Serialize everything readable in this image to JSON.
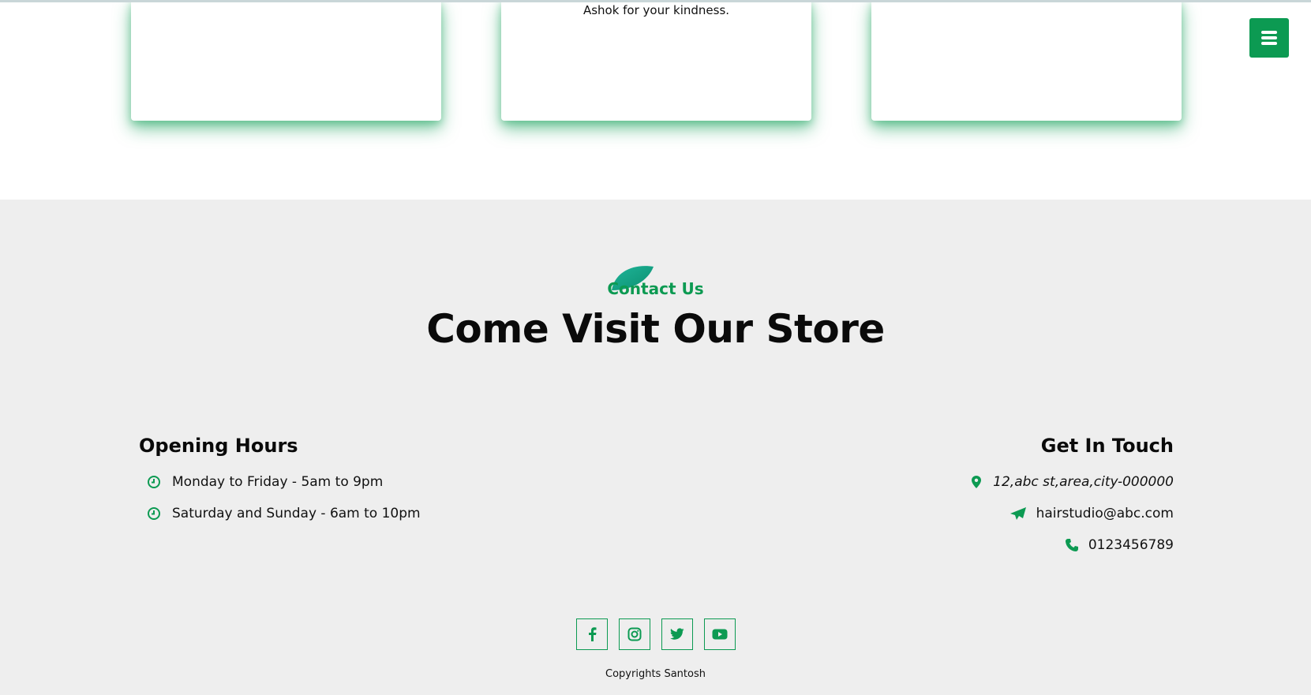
{
  "testimonials": {
    "cards": [
      {
        "text": ""
      },
      {
        "text": "Ashok for your kindness."
      },
      {
        "text": ""
      }
    ]
  },
  "menu": {
    "icon": "hamburger-icon"
  },
  "contact": {
    "eyebrow": "Contact Us",
    "headline": "Come Visit Our Store",
    "opening_hours": {
      "title": "Opening Hours",
      "items": [
        {
          "icon": "clock-icon",
          "text": "Monday to Friday - 5am to 9pm"
        },
        {
          "icon": "clock-icon",
          "text": "Saturday and Sunday - 6am to 10pm"
        }
      ]
    },
    "get_in_touch": {
      "title": "Get In Touch",
      "items": [
        {
          "icon": "map-pin-icon",
          "text": "12,abc st,area,city-000000"
        },
        {
          "icon": "paper-plane-icon",
          "text": "hairstudio@abc.com"
        },
        {
          "icon": "phone-icon",
          "text": "0123456789"
        }
      ]
    }
  },
  "social": [
    "facebook-icon",
    "instagram-icon",
    "twitter-icon",
    "youtube-icon"
  ],
  "footer": {
    "copyright": "Copyrights Santosh"
  },
  "colors": {
    "accent": "#0c9a52",
    "section_bg": "#eeeeee",
    "leaf": "#18a98c"
  }
}
